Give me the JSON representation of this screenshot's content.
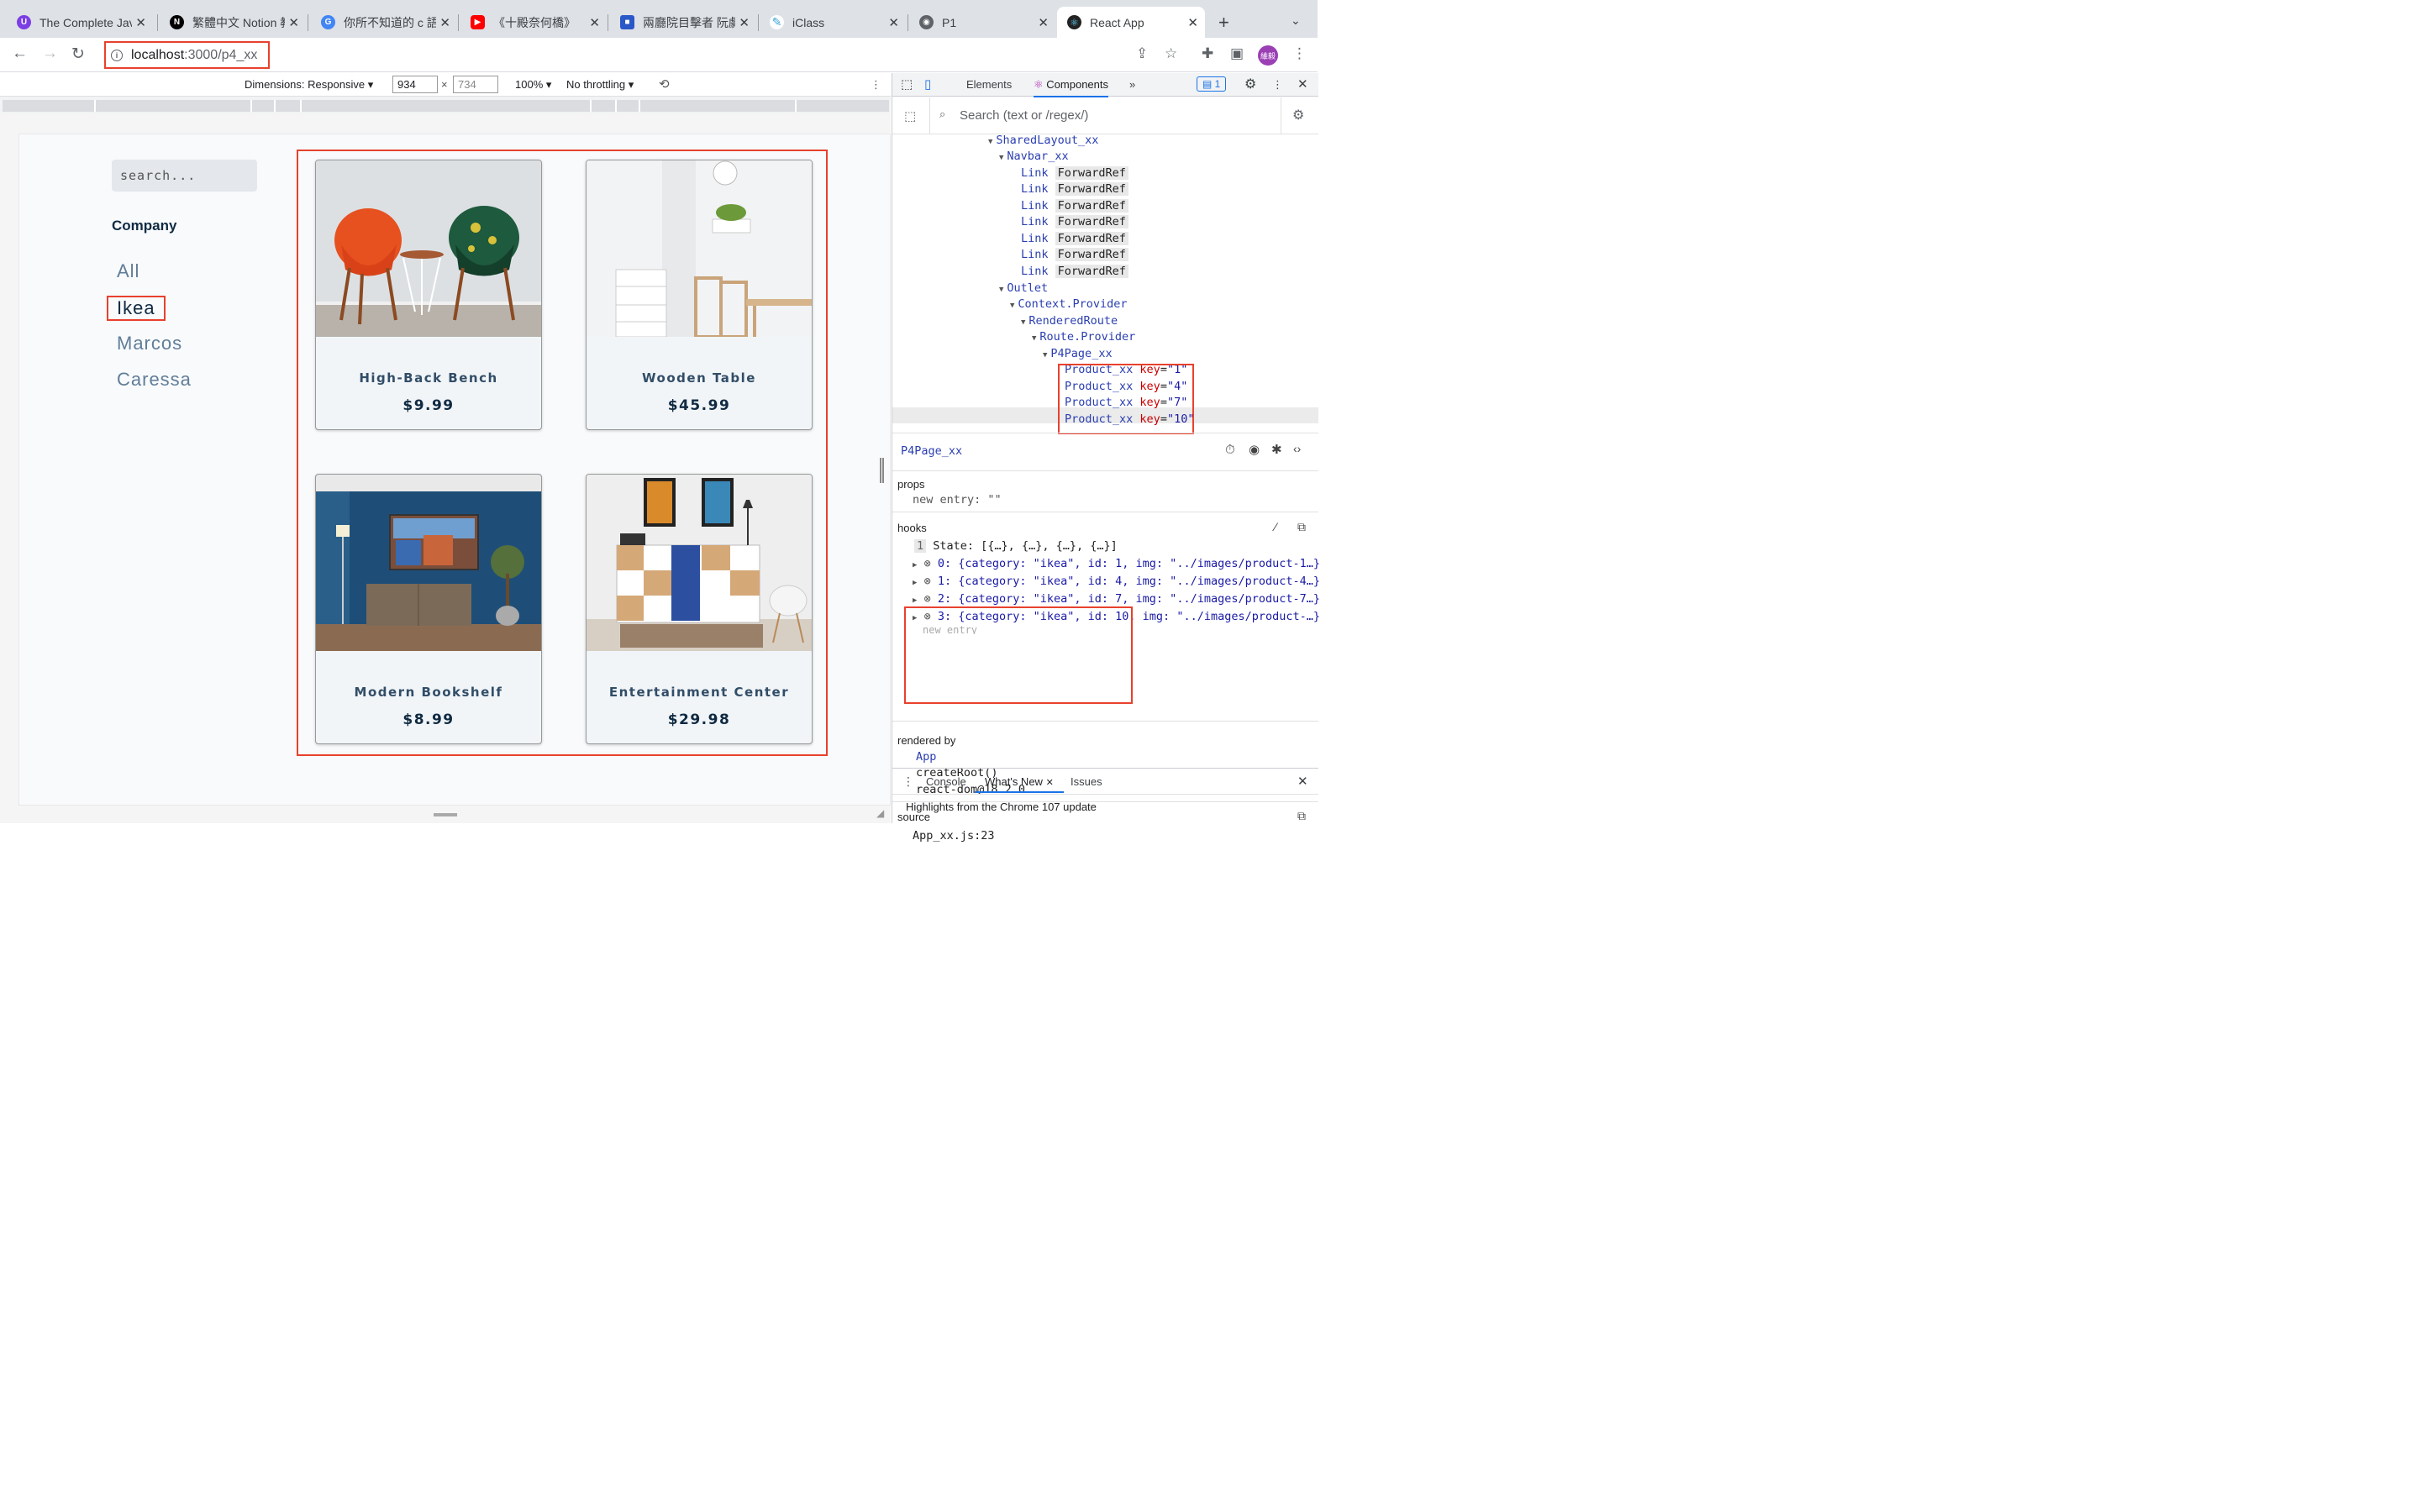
{
  "tabs": [
    {
      "title": "The Complete Java",
      "color": "#7b3fe4",
      "glyph": "U"
    },
    {
      "title": "繁體中文 Notion 教",
      "color": "#000",
      "glyph": "N"
    },
    {
      "title": "你所不知道的 c 語",
      "color": "#4285f4",
      "glyph": "G"
    },
    {
      "title": "《十殿奈何橋》",
      "color": "#ff0000",
      "glyph": "▶"
    },
    {
      "title": "兩廳院目擊者 阮劇",
      "color": "#2a58c8",
      "glyph": "■"
    },
    {
      "title": "iClass",
      "color": "#3aa3d8",
      "glyph": "✎"
    },
    {
      "title": "P1",
      "color": "#5f6368",
      "glyph": "◉"
    },
    {
      "title": "React App",
      "color": "#222",
      "glyph": "⚛"
    }
  ],
  "address": {
    "host": "localhost",
    "path": ":3000/p4_xx"
  },
  "profile": "維毅",
  "emulation": {
    "dimensions": "Dimensions: Responsive",
    "width": "934",
    "height": "734",
    "zoom": "100%",
    "throttle": "No throttling"
  },
  "page": {
    "search_placeholder": "search...",
    "company_heading": "Company",
    "categories": [
      "All",
      "Ikea",
      "Marcos",
      "Caressa"
    ],
    "products": [
      {
        "name": "High-Back Bench",
        "price": "$9.99"
      },
      {
        "name": "Wooden Table",
        "price": "$45.99"
      },
      {
        "name": "Modern Bookshelf",
        "price": "$8.99"
      },
      {
        "name": "Entertainment Center",
        "price": "$29.98"
      }
    ]
  },
  "devtools": {
    "tabs": [
      "Elements",
      "Components"
    ],
    "issues_count": "1",
    "search_placeholder": "Search (text or /regex/)",
    "tree": {
      "shared": "SharedLayout_xx",
      "navbar": "Navbar_xx",
      "link": "Link",
      "forward": "ForwardRef",
      "outlet": "Outlet",
      "context": "Context.Provider",
      "rendered": "RenderedRoute",
      "route": "Route.Provider",
      "page": "P4Page_xx",
      "products": [
        {
          "name": "Product_xx",
          "key": "key",
          "val": "\"1\""
        },
        {
          "name": "Product_xx",
          "key": "key",
          "val": "\"4\""
        },
        {
          "name": "Product_xx",
          "key": "key",
          "val": "\"7\""
        },
        {
          "name": "Product_xx",
          "key": "key",
          "val": "\"10\""
        }
      ]
    },
    "selected": "P4Page_xx",
    "props_label": "props",
    "props_entry": "new entry: \"\"",
    "hooks_label": "hooks",
    "state_line": "State: [{…}, {…}, {…}, {…}]",
    "state_num": "1",
    "state_items": [
      "0: {category: \"ikea\", id: 1, img: \"../images/product-1…}",
      "1: {category: \"ikea\", id: 4, img: \"../images/product-4…}",
      "2: {category: \"ikea\", id: 7, img: \"../images/product-7…}",
      "3: {category: \"ikea\", id: 10, img: \"../images/product-…}"
    ],
    "new_entry": "new entry",
    "rendered_by_label": "rendered by",
    "rendered_by": [
      "App",
      "createRoot()",
      "react-dom@18.2.0"
    ],
    "source_label": "source",
    "source": "App_xx.js:23",
    "drawer_tabs": [
      "Console",
      "What's New",
      "Issues"
    ],
    "drawer_text": "Highlights from the Chrome 107 update"
  }
}
